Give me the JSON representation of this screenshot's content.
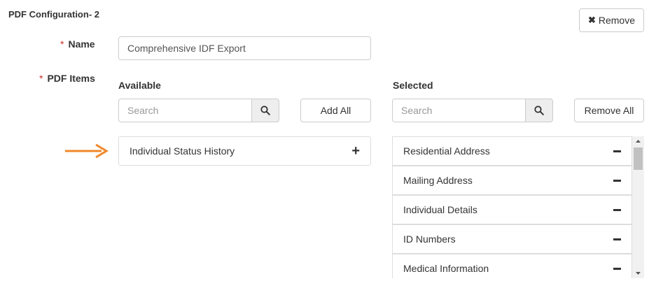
{
  "section": {
    "title": "PDF Configuration- 2"
  },
  "toolbar": {
    "remove_label": "Remove",
    "remove_icon": "times-icon"
  },
  "form": {
    "required_mark": "*",
    "name_label": "Name",
    "name_value": "Comprehensive IDF Export",
    "items_label": "PDF Items"
  },
  "available": {
    "heading": "Available",
    "search_placeholder": "Search",
    "add_all_label": "Add All",
    "items": [
      {
        "label": "Individual Status History",
        "action_icon": "plus-icon"
      }
    ]
  },
  "selected": {
    "heading": "Selected",
    "search_placeholder": "Search",
    "remove_all_label": "Remove All",
    "items": [
      {
        "label": "Residential Address",
        "action_icon": "minus-icon"
      },
      {
        "label": "Mailing Address",
        "action_icon": "minus-icon"
      },
      {
        "label": "Individual Details",
        "action_icon": "minus-icon"
      },
      {
        "label": "ID Numbers",
        "action_icon": "minus-icon"
      },
      {
        "label": "Medical Information",
        "action_icon": "minus-icon"
      }
    ]
  },
  "colors": {
    "required": "#c9302c",
    "arrow": "#f0882a",
    "border": "#cccccc",
    "addon_bg": "#eeeeee"
  }
}
